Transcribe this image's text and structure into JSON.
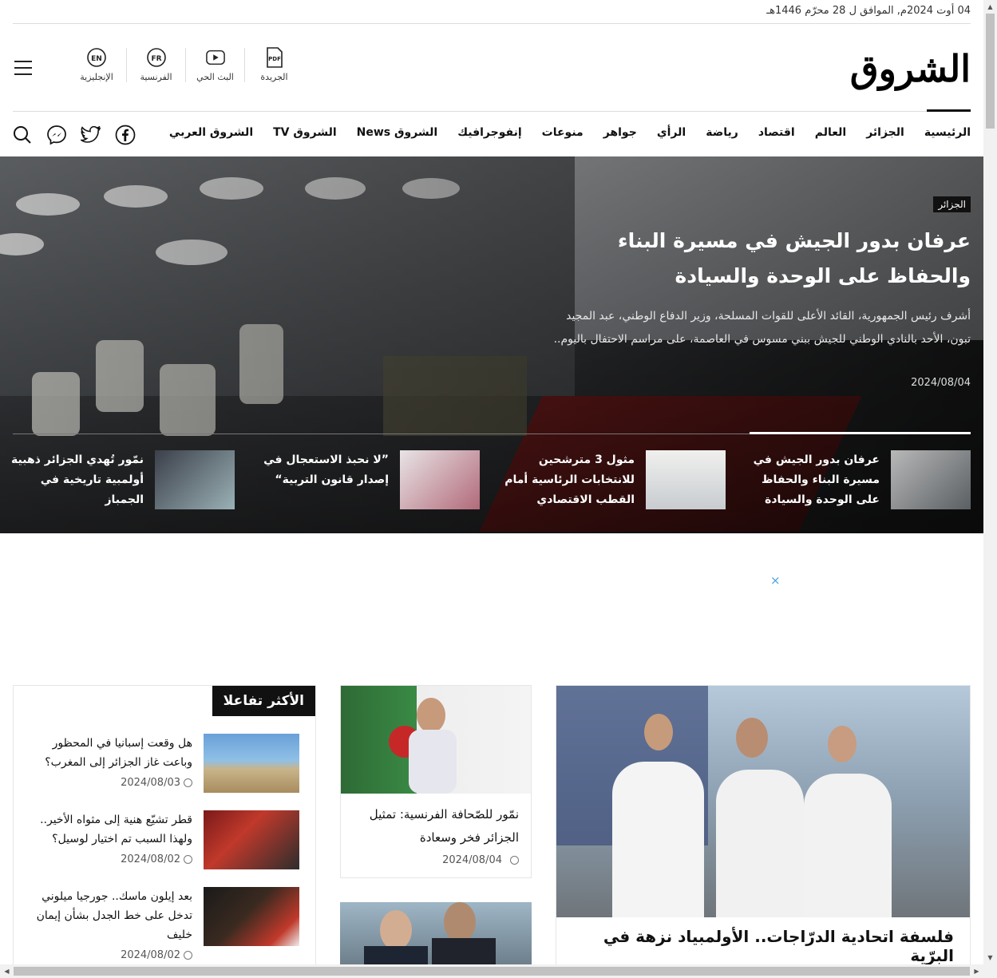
{
  "date_line": "04 أوت 2024م, الموافق ل 28 محرّم 1446هـ",
  "logo": "الشروق",
  "tools": [
    {
      "icon": "pdf-icon",
      "label": "الجريدة"
    },
    {
      "icon": "youtube-icon",
      "label": "البث الحي"
    },
    {
      "icon": "french-lang-icon",
      "label": "الفرنسية"
    },
    {
      "icon": "english-lang-icon",
      "label": "الإنجليزية"
    }
  ],
  "nav": [
    "الرئيسية",
    "الجزائر",
    "العالم",
    "اقتصاد",
    "رياضة",
    "الرأي",
    "جواهر",
    "منوعات",
    "إنفوجرافيك",
    "الشروق News",
    "الشروق TV",
    "الشروق العربي"
  ],
  "hero": {
    "tag": "الجزائر",
    "title": "عرفان بدور الجيش في مسيرة البناء والحفاظ على الوحدة والسيادة",
    "excerpt": "أشرف رئيس الجمهورية، القائد الأعلى للقوات المسلحة، وزير الدفاع الوطني، عبد المجيد تبون، الأحد بالنادي الوطني للجيش ببني مسوس في العاصمة، على مراسم الاحتفال باليوم..",
    "date": "2024/08/04"
  },
  "hero_mini": [
    {
      "title": "عرفان بدور الجيش في مسيرة البناء والحفاظ على الوحدة والسيادة"
    },
    {
      "title": "مثول 3 مترشحين للانتخابات الرئاسية أمام القطب الاقتصادي"
    },
    {
      "title": "”لا نحبذ الاستعجال في إصدار قانون التربية“"
    },
    {
      "title": "نمّور تُهدي الجزائر ذهبية أولمبية تاريخية في الجمباز"
    }
  ],
  "ad_close": "×",
  "feature": {
    "title": "فلسفة اتحادية الدرّاجات.. الأولمبياد نزهة في البرّية"
  },
  "card": {
    "title": "نمّور للصّحافة الفرنسية: تمثيل الجزائر فخر وسعادة",
    "date": "2024/08/04"
  },
  "most": {
    "heading": "الأكثر تفاعلا",
    "items": [
      {
        "title": "هل وقعت إسبانيا في المحظور وباعت غاز الجزائر إلى المغرب؟",
        "date": "2024/08/03"
      },
      {
        "title": "قطر تشيّع هنية إلى مثواه الأخير.. ولهذا السبب تم اختيار لوسيل؟",
        "date": "2024/08/02"
      },
      {
        "title": "بعد إيلون ماسك.. جورجيا ميلوني تدخل على خط الجدل بشأن إيمان خليف",
        "date": "2024/08/02"
      }
    ]
  }
}
